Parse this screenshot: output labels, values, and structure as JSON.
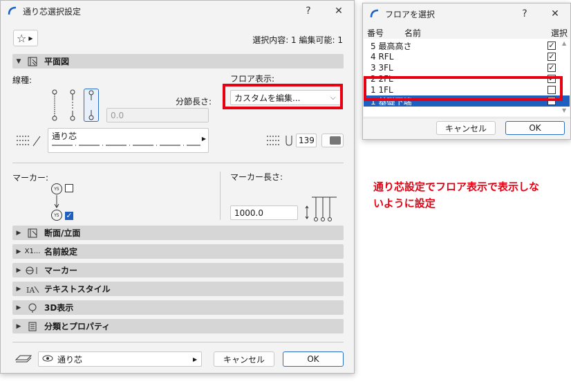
{
  "main_dialog": {
    "title": "通り芯選択設定",
    "help": "?",
    "close": "✕",
    "selection_info": "選択内容: 1 編集可能: 1",
    "section_plan": "平面図",
    "line_type_label": "線種:",
    "floor_display_label": "フロア表示:",
    "floor_display_value": "カスタムを編集...",
    "segment_length_label": "分節長さ:",
    "segment_length_value": "0.0",
    "line_name": "通り芯",
    "pen_number": "139",
    "marker_label": "マーカー:",
    "marker_length_label": "マーカー長さ:",
    "marker_length_value": "1000.0",
    "marker_tag_1": "Y5",
    "marker_tag_2": "Y5",
    "sections": [
      {
        "label": "断面/立面"
      },
      {
        "label": "名前設定",
        "icon_text": "X1..."
      },
      {
        "label": "マーカー"
      },
      {
        "label": "テキストスタイル"
      },
      {
        "label": "3D表示"
      },
      {
        "label": "分類とプロパティ"
      }
    ],
    "layer_value": "通り芯",
    "cancel": "キャンセル",
    "ok": "OK"
  },
  "floor_dialog": {
    "title": "フロアを選択",
    "help": "?",
    "close": "✕",
    "col_number": "番号",
    "col_name": "名前",
    "col_select": "選択",
    "rows": [
      {
        "label": "5 最高高さ",
        "checked": true
      },
      {
        "label": "4 RFL",
        "checked": true
      },
      {
        "label": "3 3FL",
        "checked": true
      },
      {
        "label": "2 2FL",
        "checked": true
      },
      {
        "label": "1 1FL",
        "checked": false
      },
      {
        "label": "1 基礎下端",
        "checked": true,
        "selected": true
      }
    ],
    "cancel": "キャンセル",
    "ok": "OK"
  },
  "annotation": "通り芯設定でフロア表示で表示しないように設定",
  "colors": {
    "highlight": "#e60012",
    "selection": "#1f5fbf",
    "annotation": "#e60012"
  }
}
